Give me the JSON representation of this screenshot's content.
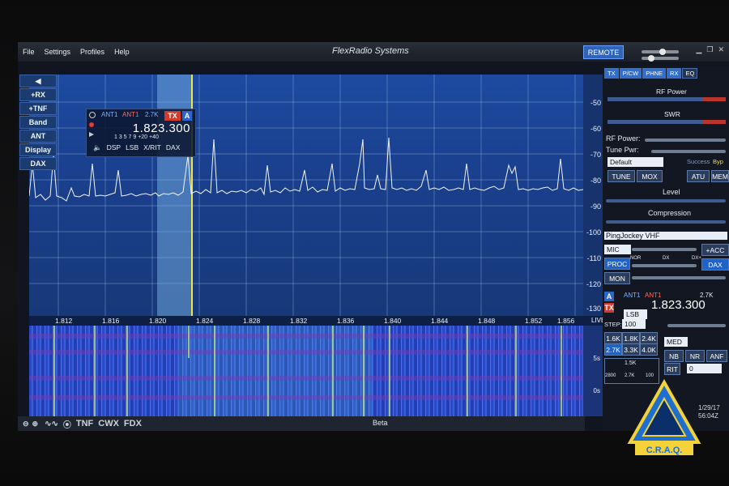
{
  "menu": {
    "file": "File",
    "settings": "Settings",
    "profiles": "Profiles",
    "help": "Help"
  },
  "brand": "FlexRadio Systems",
  "remote_label": "REMOTE",
  "left_buttons": [
    "+RX",
    "+TNF",
    "Band",
    "ANT",
    "Display",
    "DAX"
  ],
  "slice": {
    "ant_rx": "ANT1",
    "ant_tx": "ANT1",
    "bw": "2.7K",
    "tx_badge": "TX",
    "slice_letter": "A",
    "frequency": "1.823.300",
    "scale": "1 3 5 7 9 +20 +40",
    "controls": [
      "DSP",
      "LSB",
      "X/RIT",
      "DAX"
    ]
  },
  "db_scale": [
    "-50",
    "-60",
    "-70",
    "-80",
    "-90",
    "-100",
    "-110",
    "-120",
    "-130"
  ],
  "freq_ticks": [
    "1.812",
    "1.816",
    "1.820",
    "1.824",
    "1.828",
    "1.832",
    "1.836",
    "1.840",
    "1.844",
    "1.848",
    "1.852",
    "1.856"
  ],
  "live_label": "LIVE",
  "waterfall_scale": [
    "5s",
    "0s"
  ],
  "bottom": {
    "tnf": "TNF",
    "cwx": "CWX",
    "fdx": "FDX",
    "beta": "Beta"
  },
  "right_panel": {
    "tabs": [
      "TX",
      "P/CW",
      "PHNE",
      "RX",
      "EQ"
    ],
    "rf_power_label": "RF Power",
    "swr_label": "SWR",
    "rf_power_text": "RF Power:",
    "tune_pwr_text": "Tune Pwr:",
    "profile_select": "Default",
    "tune": "TUNE",
    "mox": "MOX",
    "atu": "ATU",
    "mem": "MEM",
    "success": "Success",
    "byp": "Byp",
    "level_label": "Level",
    "compression_label": "Compression",
    "profile_name": "PingJockey VHF",
    "mic_select": "MIC",
    "acc": "+ACC",
    "proc": "PROC",
    "nor": "NOR",
    "dx": "DX",
    "dxp": "DX+",
    "dax": "DAX",
    "mon": "MON",
    "rx_ant1": "ANT1",
    "rx_ant2": "ANT1",
    "rx_bw": "2.7K",
    "rx_freq": "1.823.300",
    "step_label": "STEP:",
    "step_value": "100",
    "mode_select": "LSB",
    "filters": [
      "1.6K",
      "1.8K",
      "2.4K",
      "2.7K",
      "3.3K",
      "4.0K"
    ],
    "agc": "MED",
    "nb": "NB",
    "nr": "NR",
    "anf": "ANF",
    "rit": "RIT",
    "rit_val": "0",
    "filter_bw": "1.5K",
    "filter_lo": "2800",
    "filter_mid": "2.7K",
    "filter_hi": "100"
  },
  "datetime": {
    "date": "1/29/17",
    "time": "56:04Z"
  },
  "logo_text": "C.R.A.Q."
}
